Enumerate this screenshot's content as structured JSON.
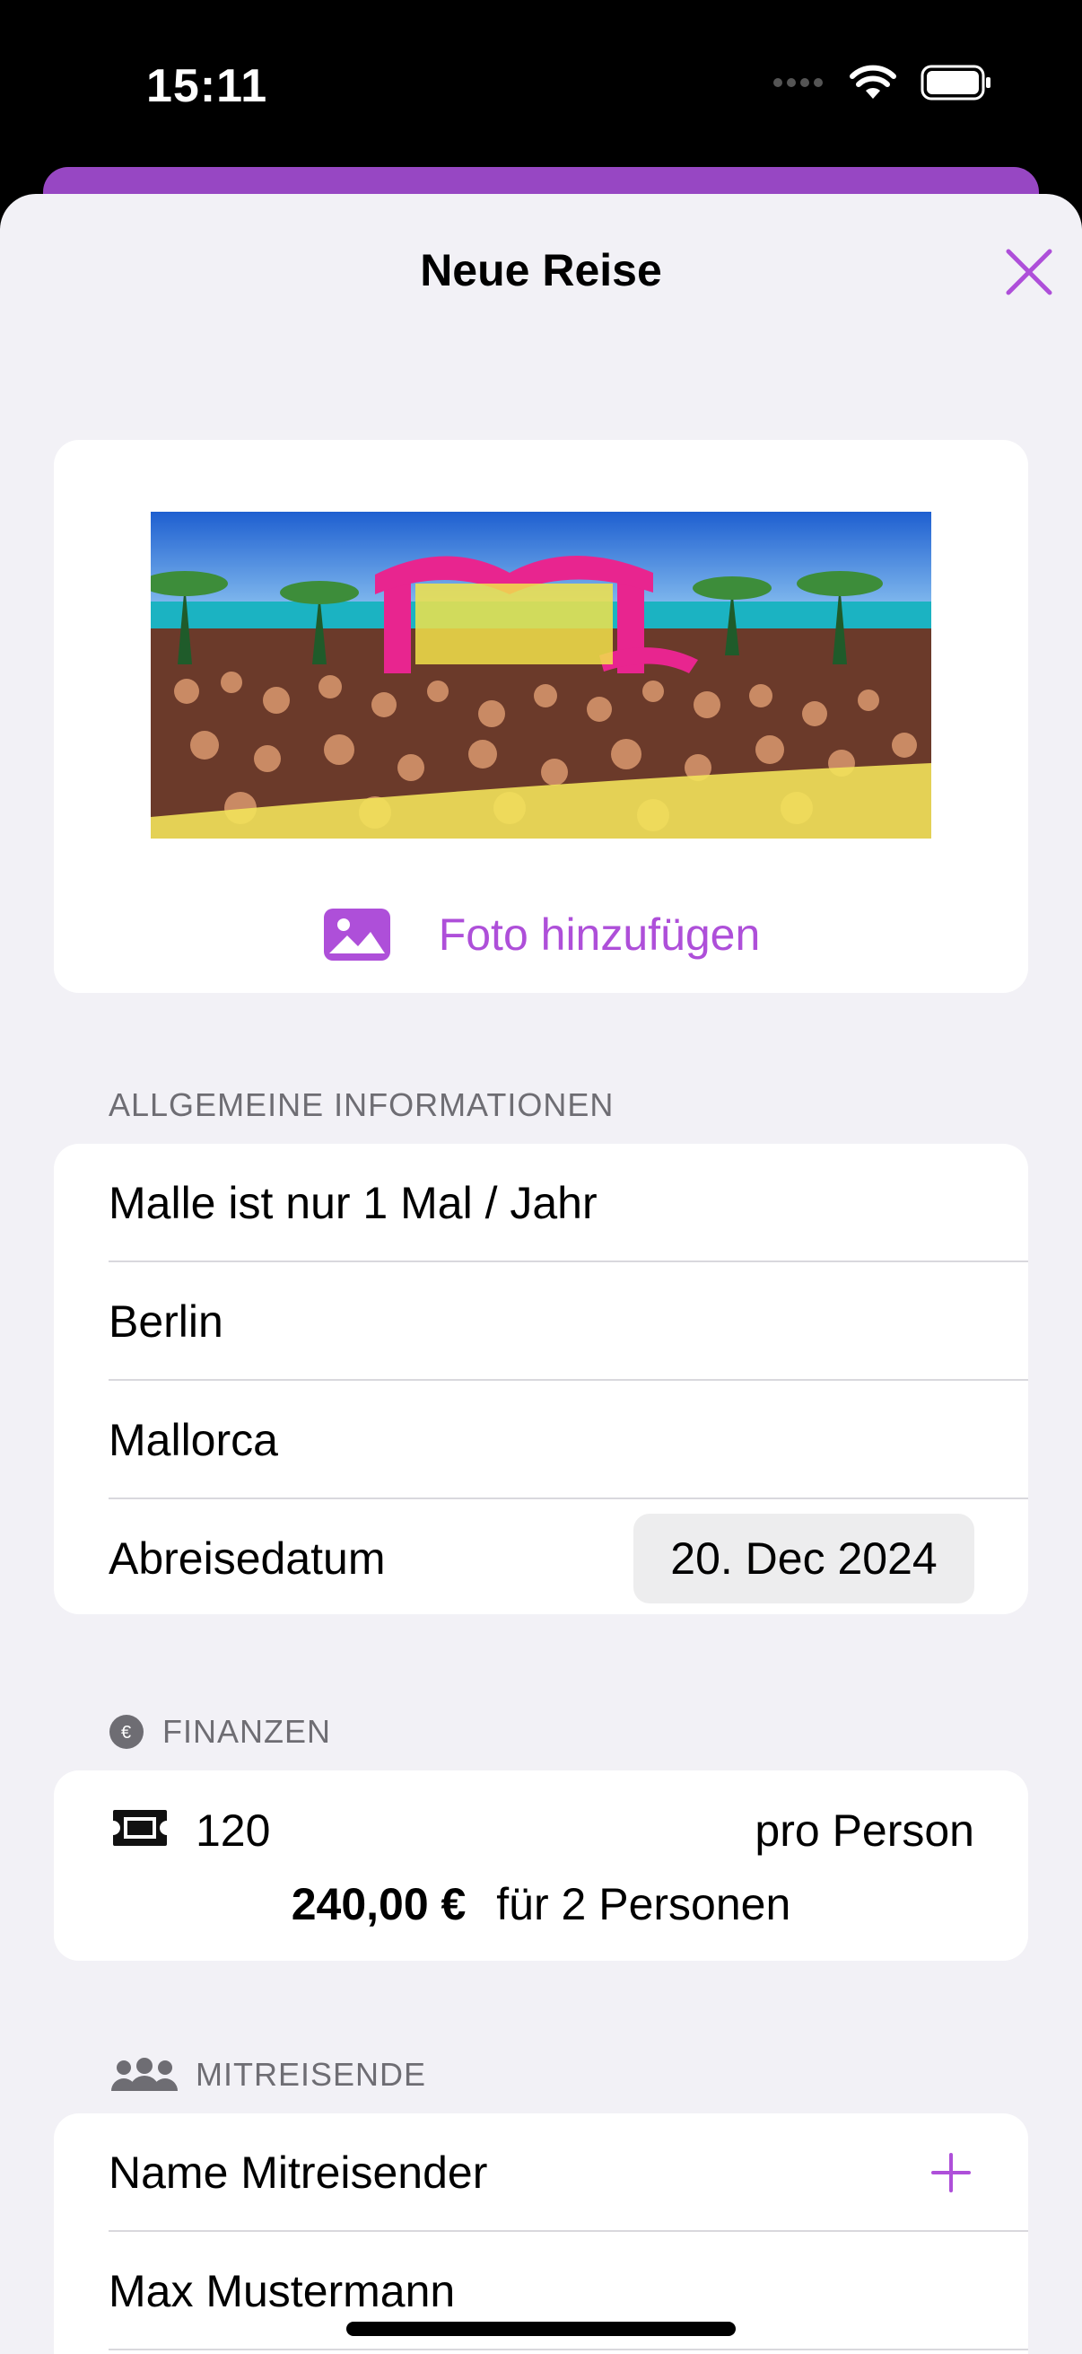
{
  "status_bar": {
    "time": "15:11"
  },
  "sheet": {
    "title": "Neue Reise",
    "close_icon": "close-icon"
  },
  "photo_card": {
    "add_photo_label": "Foto hinzufügen",
    "photo_icon": "photo-icon"
  },
  "general": {
    "header": "ALLGEMEINE INFORMATIONEN",
    "trip_name": "Malle ist nur 1 Mal / Jahr",
    "origin": "Berlin",
    "destination": "Mallorca",
    "departure_label": "Abreisedatum",
    "departure_date": "20. Dec 2024"
  },
  "finances": {
    "header": "FINANZEN",
    "price_per_person": "120",
    "per_person_label": "pro Person",
    "total": "240,00 €",
    "total_suffix": "für 2 Personen"
  },
  "companions": {
    "header": "MITREISENDE",
    "name_placeholder": "Name Mitreisender",
    "items": [
      "Max Mustermann"
    ]
  },
  "colors": {
    "accent": "#ae4fd9",
    "sheet_header_bar": "#9747c3",
    "background": "#f2f1f6"
  }
}
